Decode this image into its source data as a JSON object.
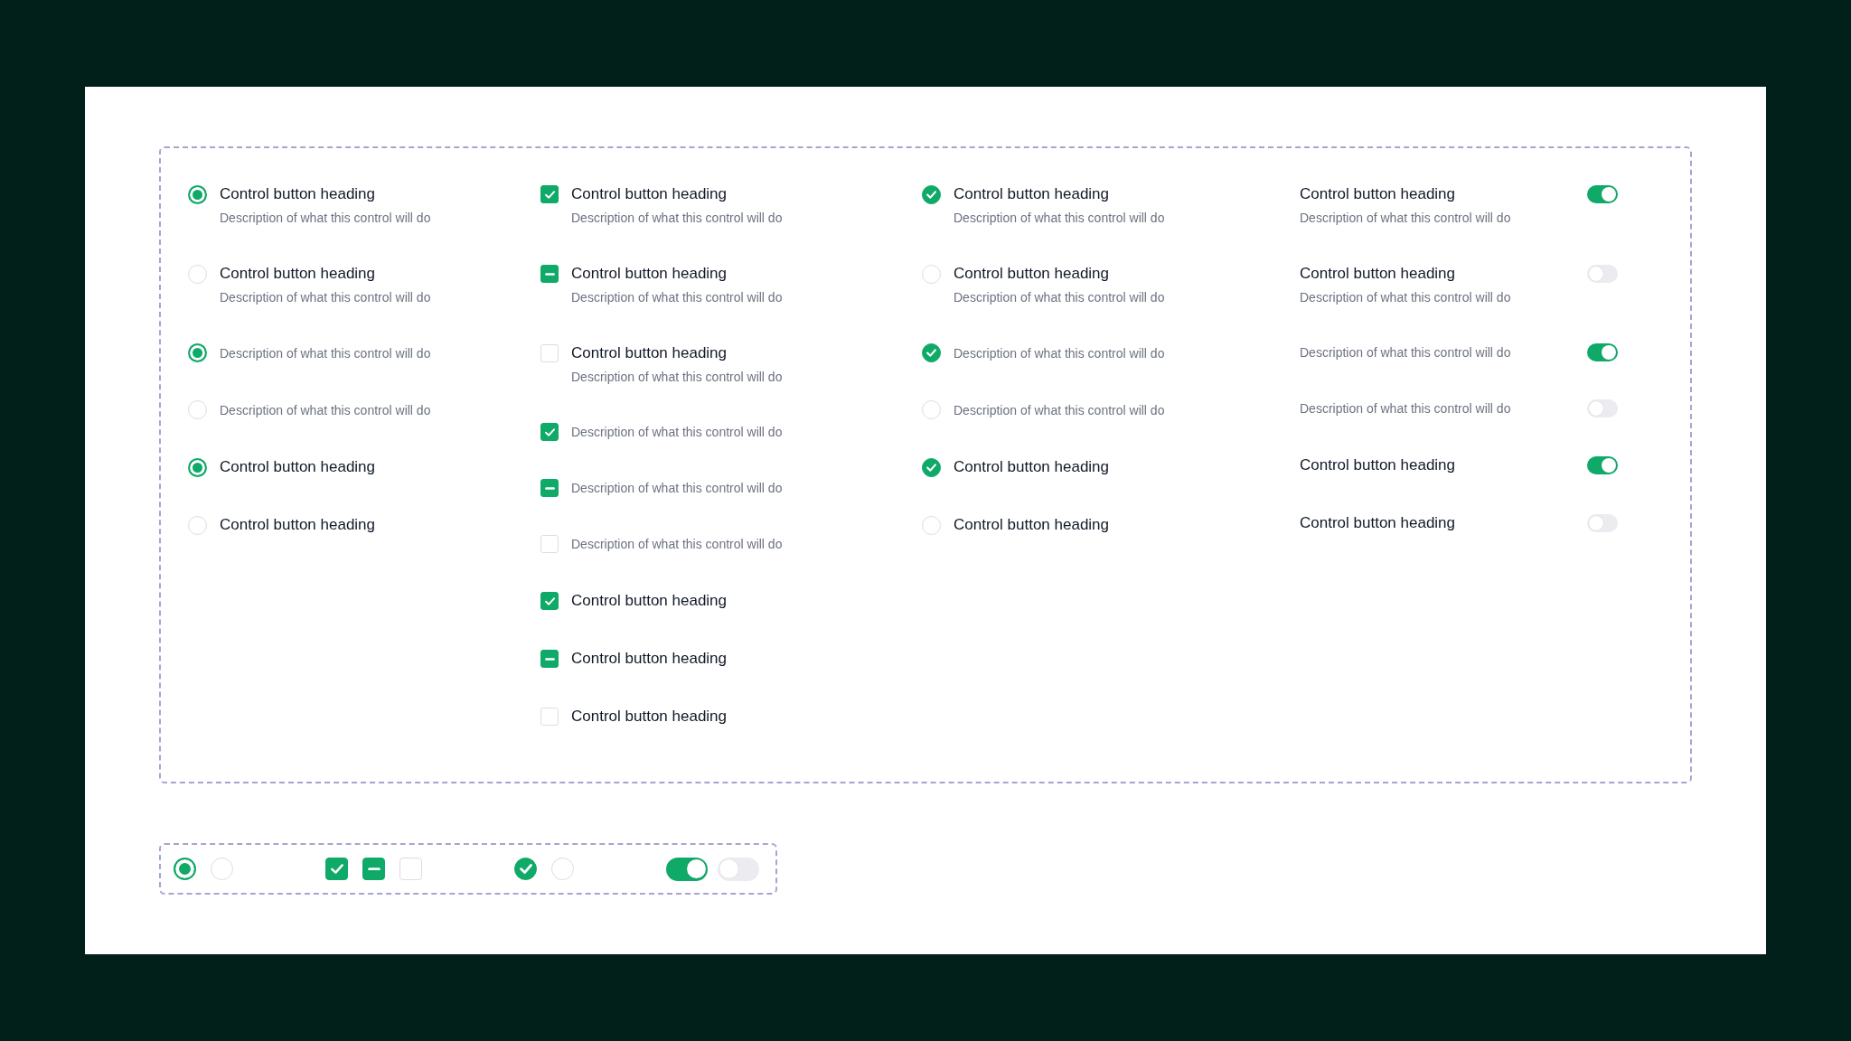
{
  "groups": [
    {
      "kind": "radio",
      "items": [
        {
          "heading": "Control button heading",
          "description": "Description of what this control will do",
          "selected": true
        },
        {
          "heading": "Control button heading",
          "description": "Description of what this control will do",
          "selected": false
        },
        {
          "description": "Description of what this control will do",
          "selected": true
        },
        {
          "description": "Description of what this control will do",
          "selected": false
        },
        {
          "heading": "Control button heading",
          "selected": true
        },
        {
          "heading": "Control button heading",
          "selected": false
        }
      ]
    },
    {
      "kind": "checkbox",
      "items": [
        {
          "heading": "Control button heading",
          "description": "Description of what this control will do",
          "kind": "tick",
          "checked": true
        },
        {
          "heading": "Control button heading",
          "description": "Description of what this control will do",
          "kind": "dash",
          "checked": true
        },
        {
          "heading": "Control button heading",
          "description": "Description of what this control will do",
          "kind": "tick",
          "checked": false
        },
        {
          "description": "Description of what this control will do",
          "kind": "tick",
          "checked": true
        },
        {
          "description": "Description of what this control will do",
          "kind": "dash",
          "checked": true
        },
        {
          "description": "Description of what this control will do",
          "kind": "tick",
          "checked": false
        },
        {
          "heading": "Control button heading",
          "kind": "tick",
          "checked": true
        },
        {
          "heading": "Control button heading",
          "kind": "dash",
          "checked": true
        },
        {
          "heading": "Control button heading",
          "kind": "tick",
          "checked": false
        }
      ]
    },
    {
      "kind": "check-circle",
      "items": [
        {
          "heading": "Control button heading",
          "description": "Description of what this control will do",
          "checked": true
        },
        {
          "heading": "Control button heading",
          "description": "Description of what this control will do",
          "checked": false
        },
        {
          "description": "Description of what this control will do",
          "checked": true
        },
        {
          "description": "Description of what this control will do",
          "checked": false
        },
        {
          "heading": "Control button heading",
          "checked": true
        },
        {
          "heading": "Control button heading",
          "checked": false
        }
      ]
    },
    {
      "kind": "toggle",
      "items": [
        {
          "heading": "Control button heading",
          "description": "Description of what this control will do",
          "on": true
        },
        {
          "heading": "Control button heading",
          "description": "Description of what this control will do",
          "on": false
        },
        {
          "description": "Description of what this control will do",
          "on": true
        },
        {
          "description": "Description of what this control will do",
          "on": false
        },
        {
          "heading": "Control button heading",
          "on": true
        },
        {
          "heading": "Control button heading",
          "on": false
        }
      ]
    }
  ],
  "samples": [
    {
      "kind": "radio",
      "selected": true
    },
    {
      "kind": "radio",
      "selected": false
    },
    {
      "kind": "tick-checkbox",
      "checked": true
    },
    {
      "kind": "dash-checkbox",
      "checked": true
    },
    {
      "kind": "tick-checkbox",
      "checked": false
    },
    {
      "kind": "check-circle",
      "checked": true
    },
    {
      "kind": "check-circle",
      "checked": false
    },
    {
      "kind": "toggle",
      "on": true
    },
    {
      "kind": "toggle",
      "on": false
    }
  ]
}
